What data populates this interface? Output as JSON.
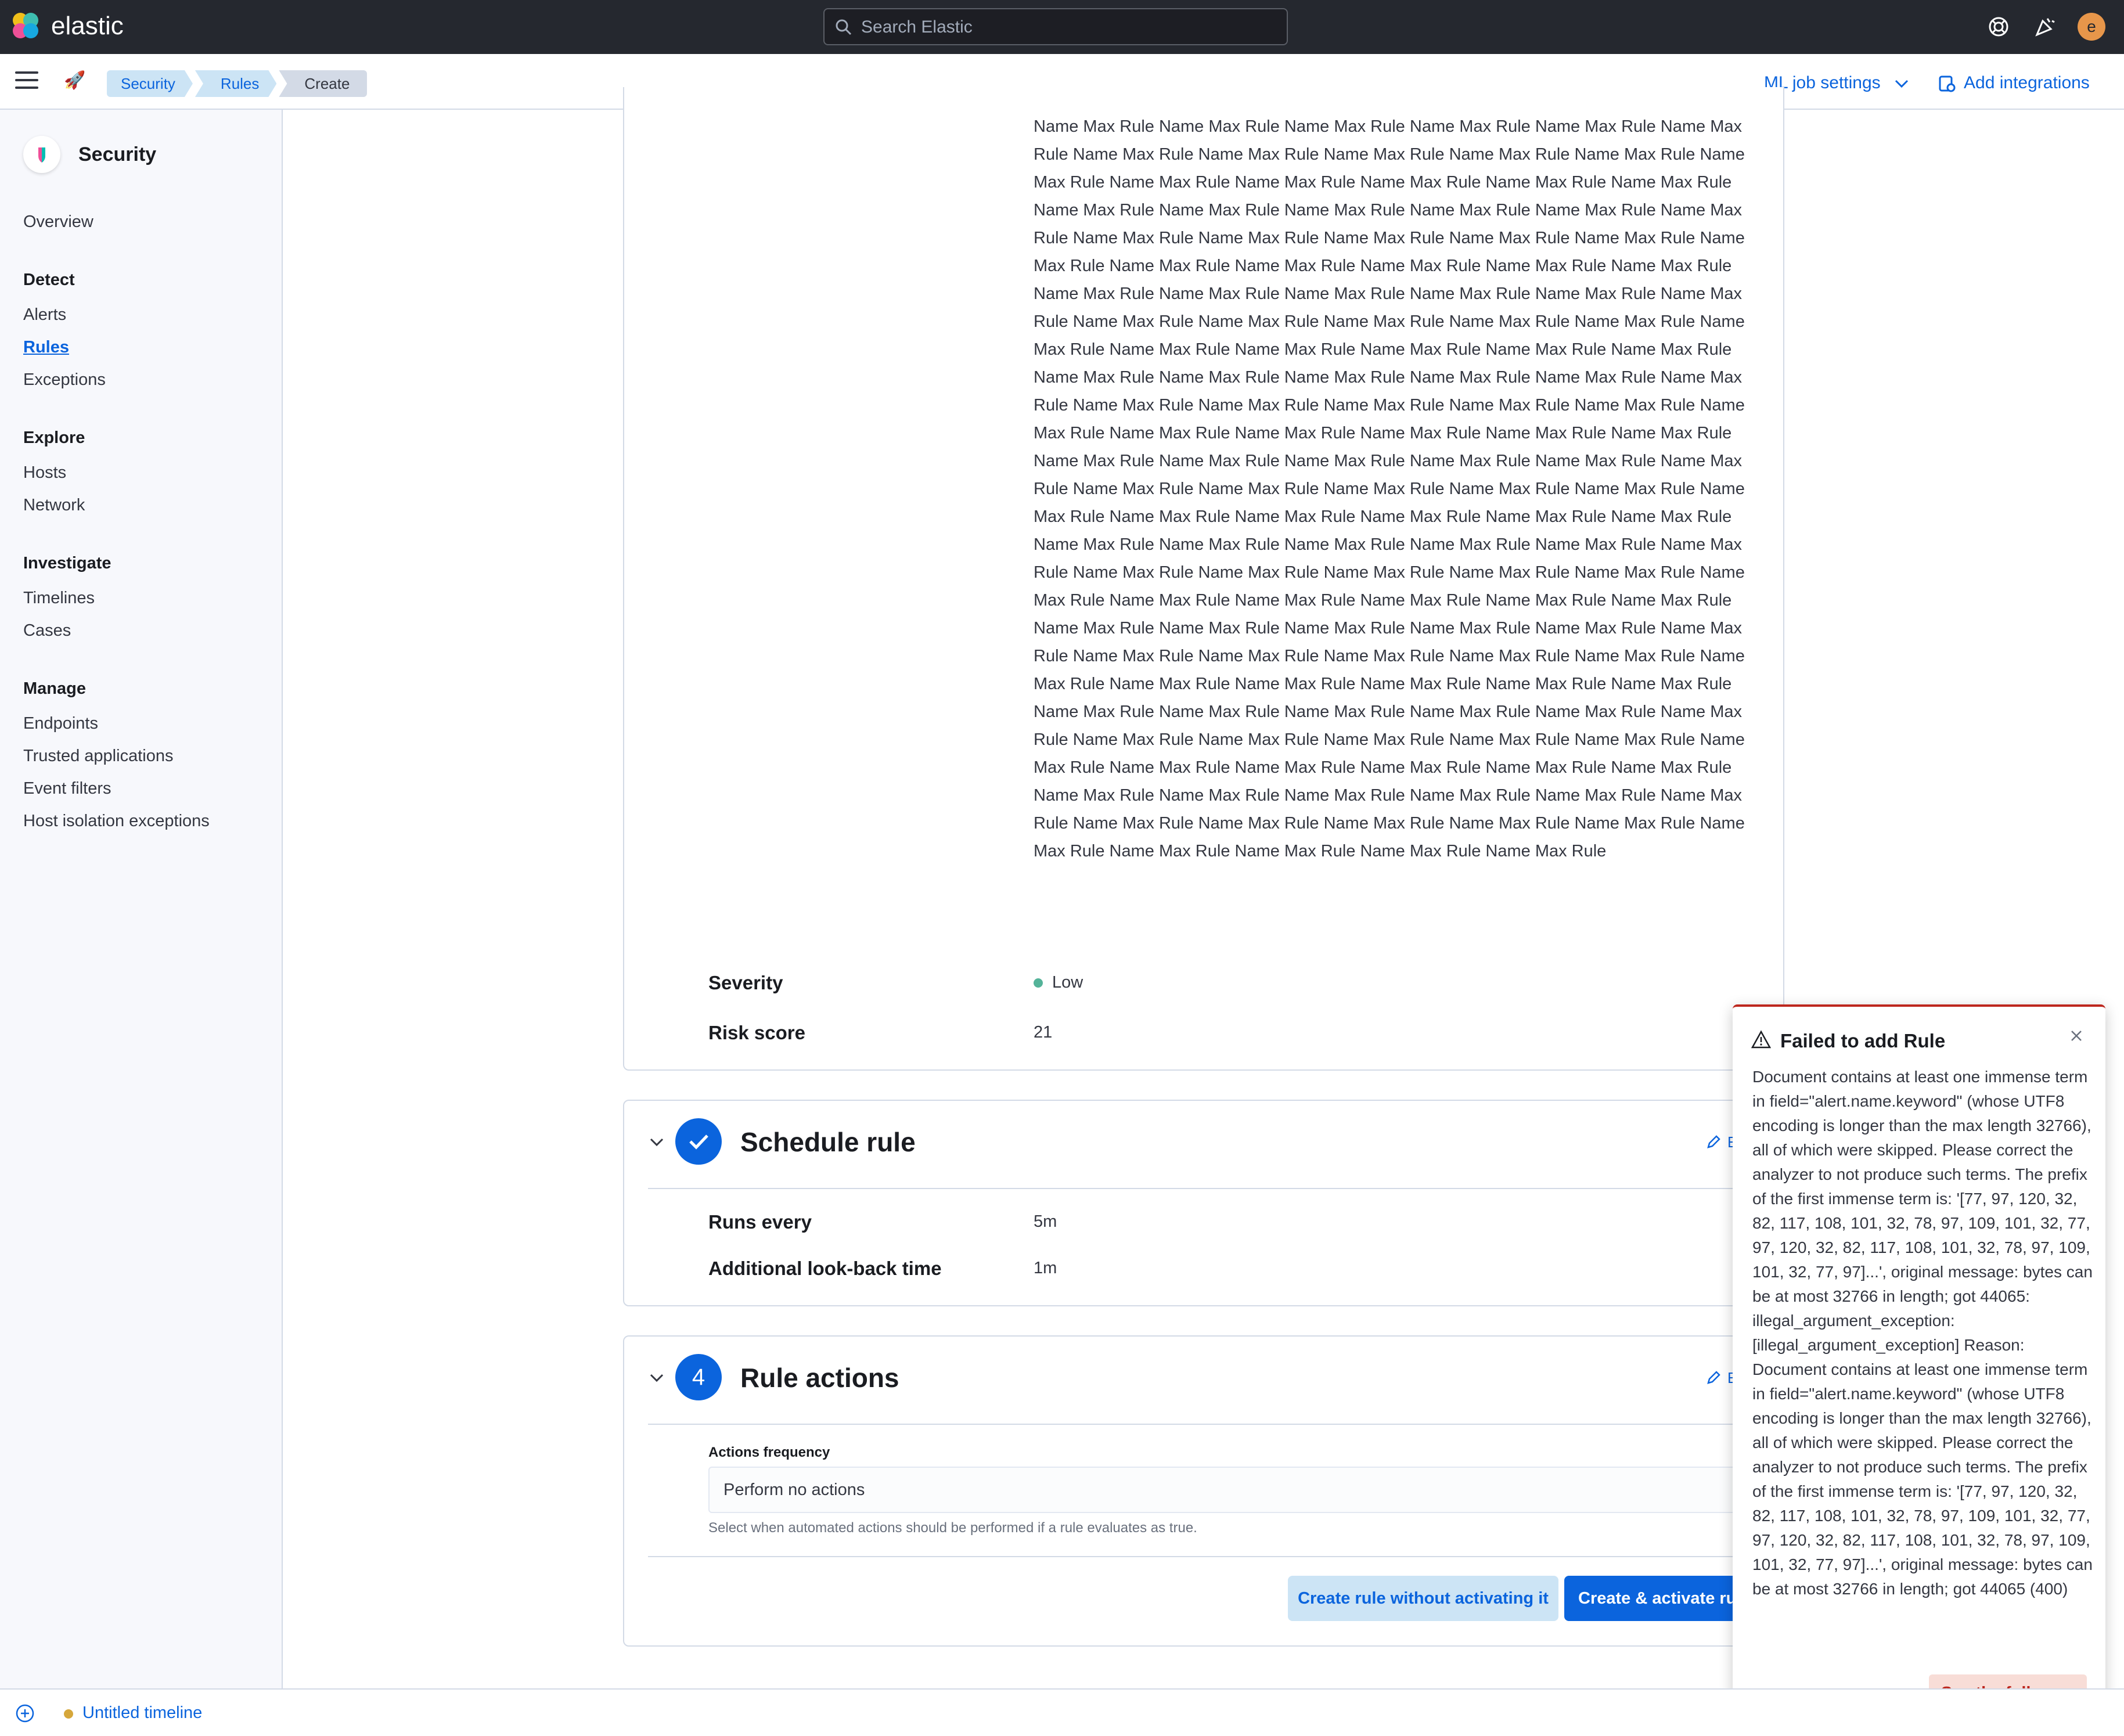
{
  "header": {
    "logo_text": "elastic",
    "search_placeholder": "Search Elastic",
    "avatar_initial": "e"
  },
  "subbar": {
    "breadcrumbs": [
      "Security",
      "Rules",
      "Create"
    ],
    "ml_settings": "ML job settings",
    "add_integrations": "Add integrations"
  },
  "sidebar": {
    "title": "Security",
    "overview": "Overview",
    "groups": {
      "detect": "Detect",
      "explore": "Explore",
      "investigate": "Investigate",
      "manage": "Manage"
    },
    "items": {
      "alerts": "Alerts",
      "rules": "Rules",
      "exceptions": "Exceptions",
      "hosts": "Hosts",
      "network": "Network",
      "timelines": "Timelines",
      "cases": "Cases",
      "endpoints": "Endpoints",
      "trusted_applications": "Trusted applications",
      "event_filters": "Event filters",
      "host_isolation_exceptions": "Host isolation exceptions"
    }
  },
  "about": {
    "rule_name_text": "Name Max Rule Name Max Rule Name Max Rule Name Max Rule Name Max Rule Name Max Rule Name Max Rule Name Max Rule Name Max Rule Name Max Rule Name Max Rule Name Max Rule Name Max Rule Name Max Rule Name Max Rule Name Max Rule Name Max Rule Name Max Rule Name Max Rule Name Max Rule Name Max Rule Name Max Rule Name Max Rule Name Max Rule Name Max Rule Name Max Rule Name Max Rule Name Max Rule Name Max Rule Name Max Rule Name Max Rule Name Max Rule Name Max Rule Name Max Rule Name Max Rule Name Max Rule Name Max Rule Name Max Rule Name Max Rule Name Max Rule Name Max Rule Name Max Rule Name Max Rule Name Max Rule Name Max Rule Name Max Rule Name Max Rule Name Max Rule Name Max Rule Name Max Rule Name Max Rule Name Max Rule Name Max Rule Name Max Rule Name Max Rule Name Max Rule Name Max Rule Name Max Rule Name Max Rule Name Max Rule Name Max Rule Name Max Rule Name Max Rule Name Max Rule Name Max Rule Name Max Rule Name Max Rule Name Max Rule Name Max Rule Name Max Rule Name Max Rule Name Max Rule Name Max Rule Name Max Rule Name Max Rule Name Max Rule Name Max Rule Name Max Rule Name Max Rule Name Max Rule Name Max Rule Name Max Rule Name Max Rule Name Max Rule Name Max Rule Name Max Rule Name Max Rule Name Max Rule Name Max Rule Name Max Rule Name Max Rule Name Max Rule Name Max Rule Name Max Rule Name Max Rule Name Max Rule Name Max Rule Name Max Rule Name Max Rule Name Max Rule Name Max Rule Name Max Rule Name Max Rule Name Max Rule Name Max Rule Name Max Rule Name Max Rule Name Max Rule Name Max Rule Name Max Rule Name Max Rule Name Max Rule Name Max Rule Name Max Rule Name Max Rule Name Max Rule Name Max Rule Name Max Rule Name Max Rule Name Max Rule Name Max Rule Name Max Rule Name Max Rule Name Max Rule Name Max Rule Name Max Rule Name Max Rule Name Max Rule Name Max Rule Name Max Rule Name Max Rule Name Max Rule Name Max Rule Name Max Rule Name Max Rule Name Max Rule Name Max Rule Name Max Rule Name Max Rule Name Max Rule Name Max Rule Name Max Rule Name Max Rule Name Max Rule Name Max Rule Name Max Rule Name Max Rule Name Max Rule Name Max Rule Name Max Rule Name Max Rule Name Max Rule",
    "severity_label": "Severity",
    "severity_value": "Low",
    "severity_color": "#54b399",
    "risk_label": "Risk score",
    "risk_value": "21"
  },
  "schedule": {
    "title": "Schedule rule",
    "runs_every_label": "Runs every",
    "runs_every_value": "5m",
    "lookback_label": "Additional look-back time",
    "lookback_value": "1m",
    "edit_label": "E"
  },
  "actions": {
    "step_number": "4",
    "title": "Rule actions",
    "edit_label": "E",
    "frequency_label": "Actions frequency",
    "frequency_value": "Perform no actions",
    "frequency_help": "Select when automated actions should be performed if a rule evaluates as true.",
    "create_without_activating": "Create rule without activating it",
    "create_and_activate": "Create & activate ru"
  },
  "toast": {
    "title": "Failed to add Rule",
    "body": "Document contains at least one immense term in field=\"alert.name.keyword\" (whose UTF8 encoding is longer than the max length 32766), all of which were skipped. Please correct the analyzer to not produce such terms. The prefix of the first immense term is: '[77, 97, 120, 32, 82, 117, 108, 101, 32, 78, 97, 109, 101, 32, 77, 97, 120, 32, 82, 117, 108, 101, 32, 78, 97, 109, 101, 32, 77, 97]...', original message: bytes can be at most 32766 in length; got 44065: illegal_argument_exception: [illegal_argument_exception] Reason: Document contains at least one immense term in field=\"alert.name.keyword\" (whose UTF8 encoding is longer than the max length 32766), all of which were skipped. Please correct the analyzer to not produce such terms. The prefix of the first immense term is: '[77, 97, 120, 32, 82, 117, 108, 101, 32, 78, 97, 109, 101, 32, 77, 97, 120, 32, 82, 117, 108, 101, 32, 78, 97, 109, 101, 32, 77, 97]...', original message: bytes can be at most 32766 in length; got 44065 (400)",
    "button": "See the full error",
    "accent_color": "#bd271e"
  },
  "timeline": {
    "title": "Untitled timeline"
  },
  "colors": {
    "primary": "#0b64dd",
    "header_bg": "#25282f",
    "danger": "#bd271e"
  }
}
